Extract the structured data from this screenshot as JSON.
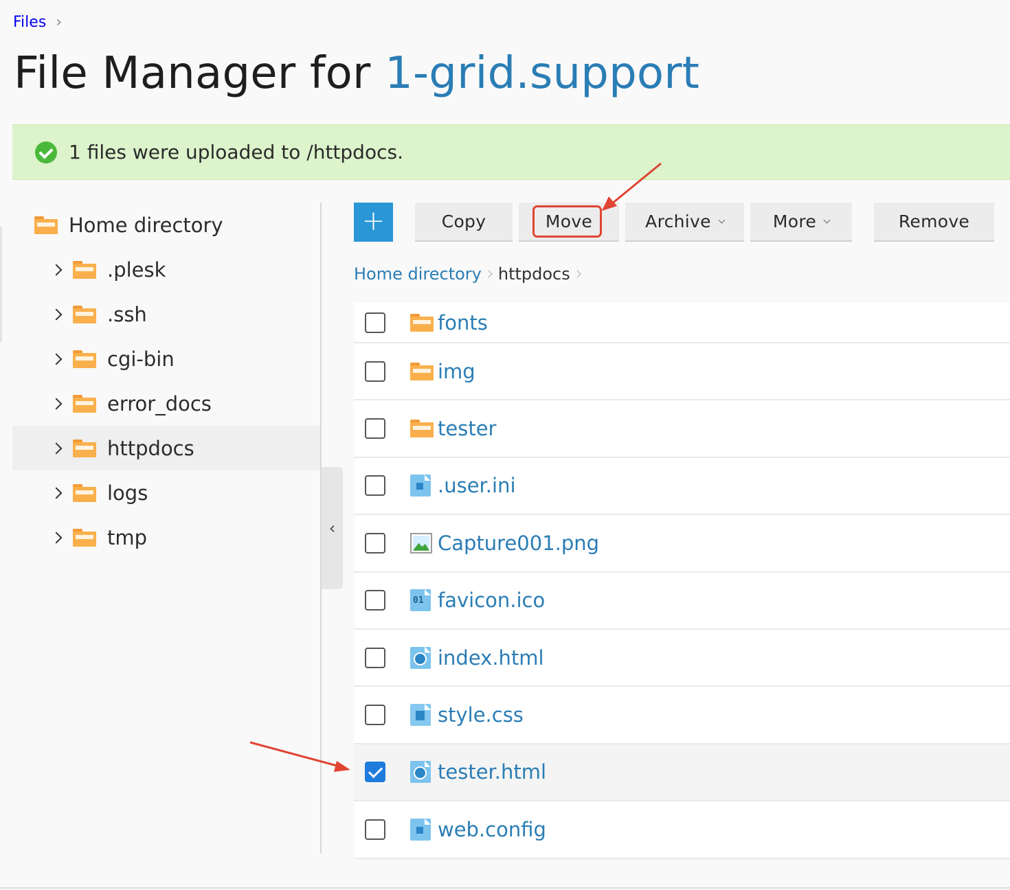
{
  "breadcrumb_top": {
    "label": "Files"
  },
  "title": {
    "prefix": "File Manager for ",
    "domain": "1-grid.support"
  },
  "banner": {
    "message": "1 files were uploaded to /httpdocs."
  },
  "tree": {
    "root": "Home directory",
    "children": [
      {
        "label": ".plesk",
        "active": false
      },
      {
        "label": ".ssh",
        "active": false
      },
      {
        "label": "cgi-bin",
        "active": false
      },
      {
        "label": "error_docs",
        "active": false
      },
      {
        "label": "httpdocs",
        "active": true
      },
      {
        "label": "logs",
        "active": false
      },
      {
        "label": "tmp",
        "active": false
      }
    ]
  },
  "toolbar": {
    "add_label": "+",
    "copy": "Copy",
    "move": "Move",
    "archive": "Archive",
    "more": "More",
    "remove": "Remove"
  },
  "path": {
    "root": "Home directory",
    "current": "httpdocs"
  },
  "files": [
    {
      "name": "fonts",
      "type": "folder",
      "checked": false
    },
    {
      "name": "img",
      "type": "folder",
      "checked": false
    },
    {
      "name": "tester",
      "type": "folder",
      "checked": false
    },
    {
      "name": ".user.ini",
      "type": "text-file",
      "checked": false
    },
    {
      "name": "Capture001.png",
      "type": "image-file",
      "checked": false
    },
    {
      "name": "favicon.ico",
      "type": "ico-file",
      "checked": false,
      "icon_text": "01"
    },
    {
      "name": "index.html",
      "type": "html-file",
      "checked": false
    },
    {
      "name": "style.css",
      "type": "css-file",
      "checked": false
    },
    {
      "name": "tester.html",
      "type": "html-file",
      "checked": true
    },
    {
      "name": "web.config",
      "type": "text-file",
      "checked": false
    }
  ],
  "colors": {
    "accent": "#2a7db5",
    "add_button": "#2996d6",
    "banner_bg": "#dcf3cb",
    "success": "#4ab93b",
    "annotation": "#e04433",
    "folder": "#f9b04c"
  }
}
